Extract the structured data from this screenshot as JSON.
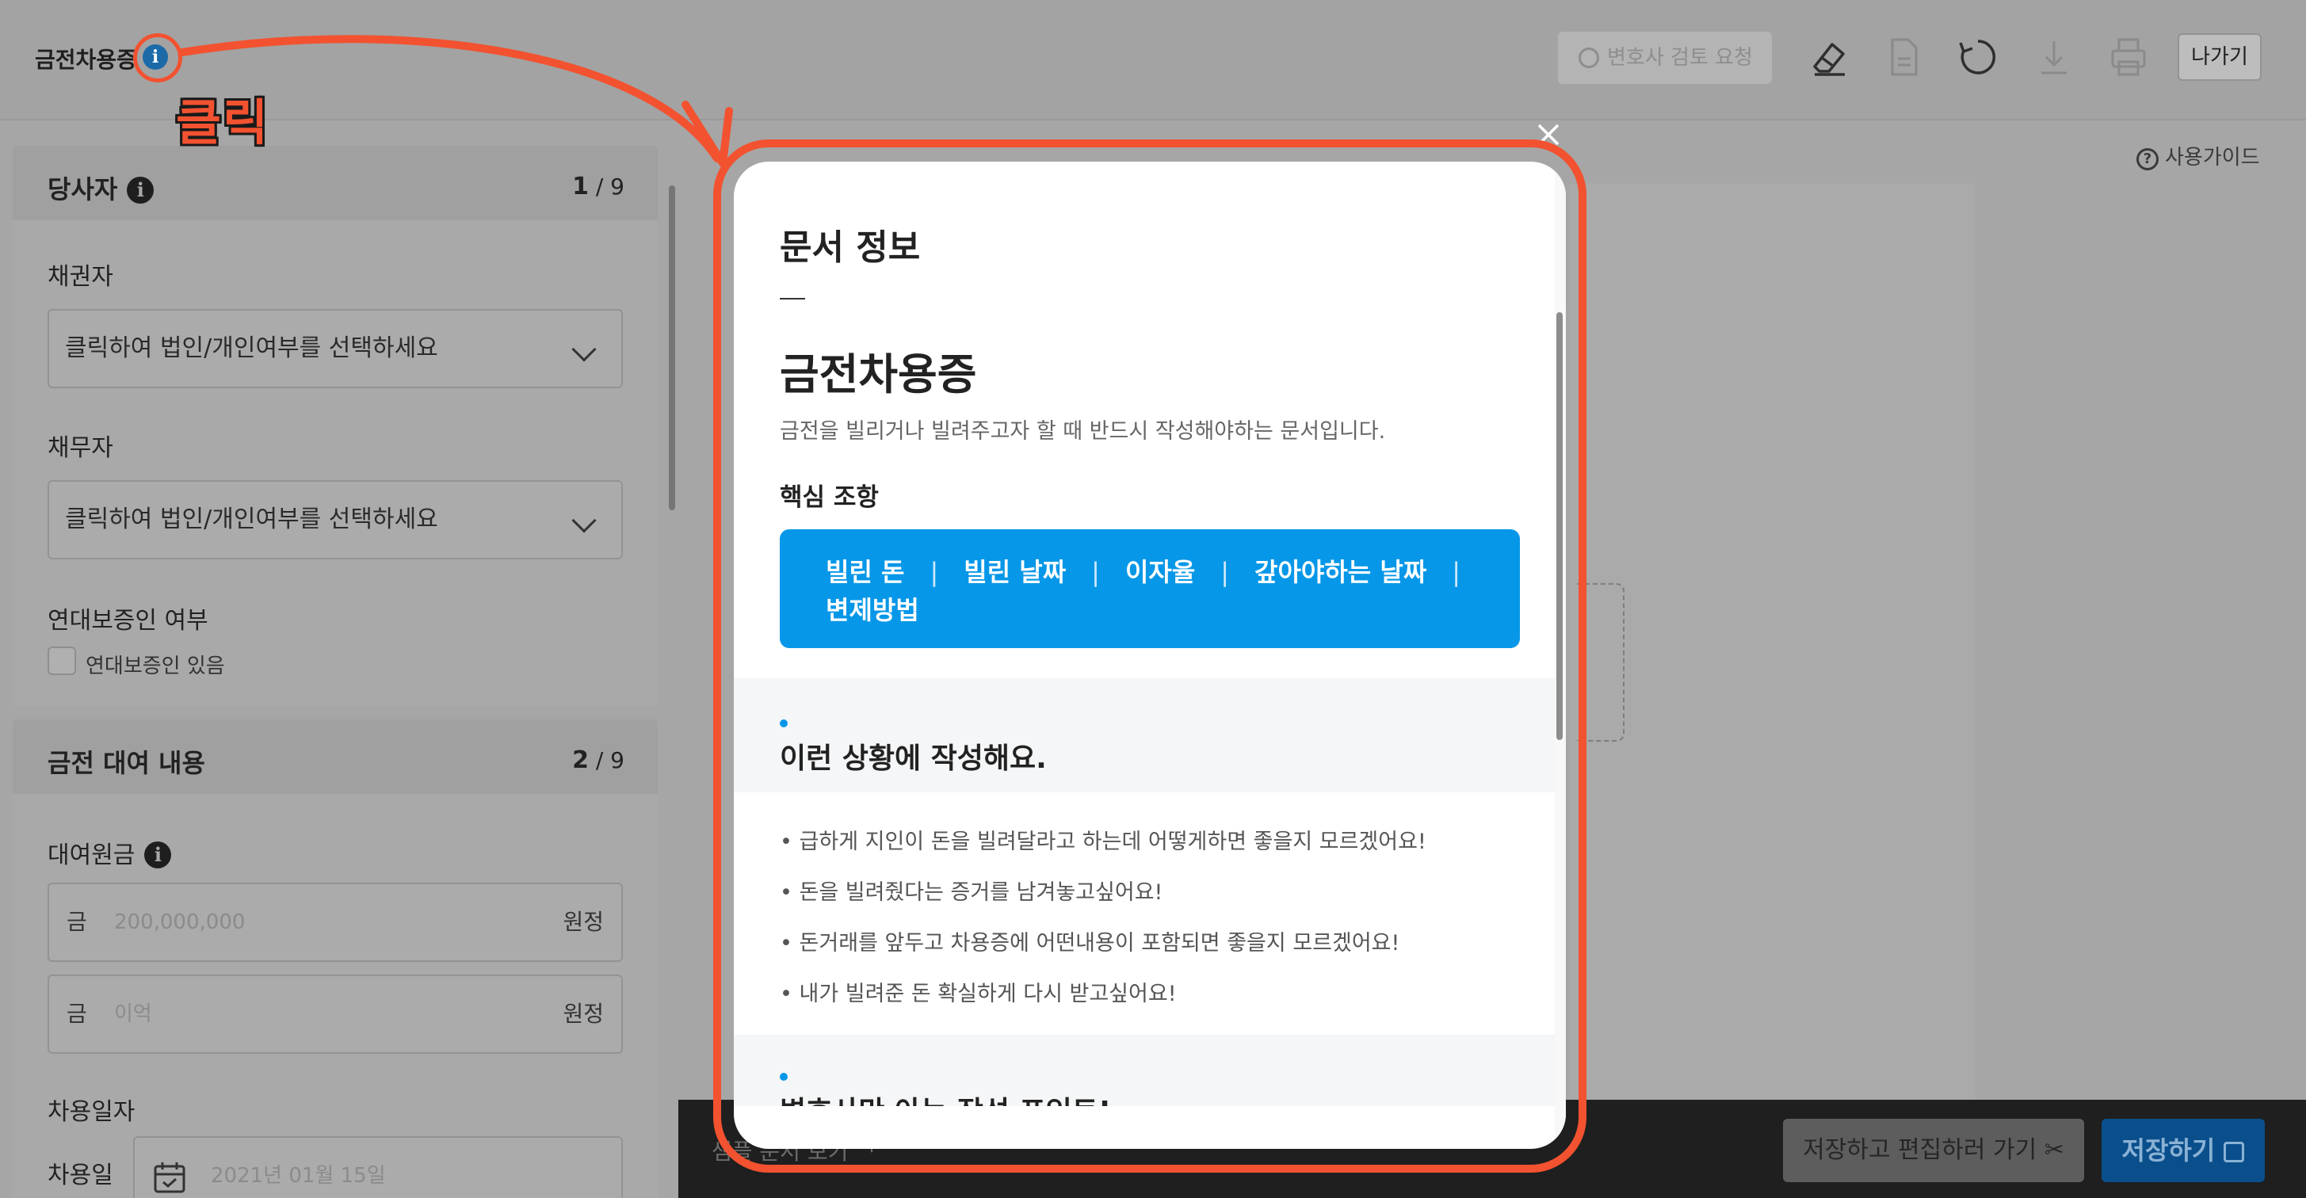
{
  "header": {
    "doc_title": "금전차용증",
    "info_glyph": "i",
    "annotation_label": "클릭",
    "lawyer_review": "변호사 검토 요청",
    "exit": "나가기",
    "icons": [
      "eraser-icon",
      "document-icon",
      "refresh-icon",
      "download-icon",
      "print-icon"
    ]
  },
  "left": {
    "section1": {
      "title": "당사자",
      "count_current": "1",
      "count_total": "/ 9",
      "creditor_label": "채권자",
      "creditor_select": "클릭하여 법인/개인여부를 선택하세요",
      "debtor_label": "채무자",
      "debtor_select": "클릭하여 법인/개인여부를 선택하세요",
      "guarantor_label": "연대보증인 여부",
      "guarantor_check": "연대보증인 있음"
    },
    "section2": {
      "title": "금전 대여 내용",
      "count_current": "2",
      "count_total": "/ 9",
      "principal_label": "대여원금",
      "prefix": "금",
      "principal_placeholder": "200,000,000",
      "suffix": "원정",
      "prefix2": "금",
      "principal_placeholder2": "이억",
      "suffix2": "원정",
      "date_section_label": "차용일자",
      "date_label": "차용일",
      "date_placeholder": "2021년 01월 15일"
    }
  },
  "main": {
    "guide": "사용가이드",
    "guide_glyph": "?",
    "sample_view": "샘플 문서 보기 ᅵ",
    "save_edit": "저장하고 편집하러 가기",
    "save": "저장하기"
  },
  "modal": {
    "heading": "문서 정보",
    "dash": "—",
    "doc_title": "금전차용증",
    "description": "금전을 빌리거나 빌려주고자 할 때 반드시 작성해야하는 문서입니다.",
    "key_terms_label": "핵심 조항",
    "key_terms": [
      "빌린 돈",
      "빌린 날짜",
      "이자율",
      "갚아야하는 날짜",
      "변제방법"
    ],
    "situation_title": "이런 상황에 작성해요.",
    "situations": [
      "• 급하게 지인이 돈을 빌려달라고 하는데 어떻게하면 좋을지 모르겠어요!",
      "• 돈을 빌려줬다는 증거를 남겨놓고싶어요!",
      "• 돈거래를 앞두고 차용증에 어떤내용이 포함되면 좋을지 모르겠어요!",
      "• 내가 빌려준 돈 확실하게 다시 받고싶어요!"
    ],
    "points_title": "변호사만 아는 작성 포인트!"
  },
  "colors": {
    "annotation": "#f25230",
    "accent": "#0797e8",
    "info": "#1c6aa8"
  }
}
